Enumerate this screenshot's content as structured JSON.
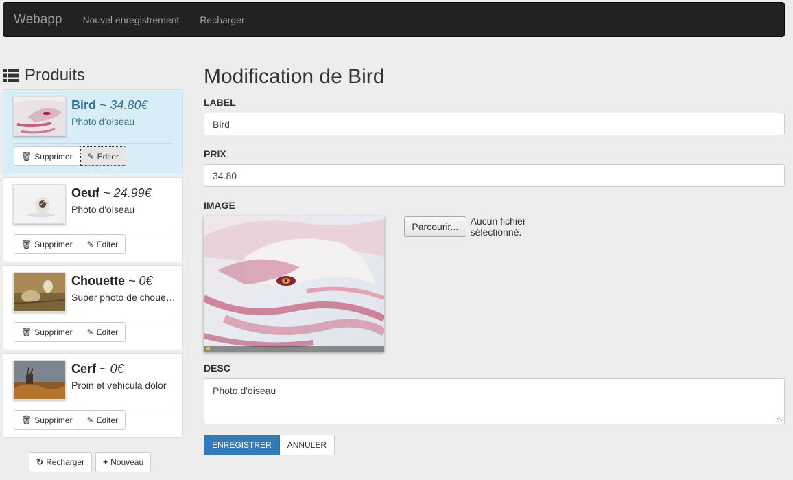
{
  "navbar": {
    "brand": "Webapp",
    "links": [
      "Nouvel enregistrement",
      "Recharger"
    ]
  },
  "sidebar": {
    "title": "Produits",
    "items": [
      {
        "name": "Bird",
        "price": "34.80€",
        "desc": "Photo d'oiseau",
        "active": true
      },
      {
        "name": "Oeuf",
        "price": "24.99€",
        "desc": "Photo d'oiseau",
        "active": false
      },
      {
        "name": "Chouette",
        "price": "0€",
        "desc": "Super photo de chouette",
        "active": false
      },
      {
        "name": "Cerf",
        "price": "0€",
        "desc": "Proin et vehicula dolor",
        "active": false
      }
    ],
    "separator": "~",
    "delete_label": "Supprimer",
    "edit_label": "Editer",
    "reload_label": "Recharger",
    "new_label": "Nouveau"
  },
  "form": {
    "title": "Modification de Bird",
    "label_label": "LABEL",
    "label_value": "Bird",
    "price_label": "PRIX",
    "price_value": "34.80",
    "image_label": "IMAGE",
    "browse_label": "Parcourir...",
    "file_status": "Aucun fichier sélectionné.",
    "desc_label": "DESC",
    "desc_value": "Photo d'oiseau",
    "save_label": "ENREGISTRER",
    "cancel_label": "ANNULER"
  },
  "colors": {
    "navbar_bg": "#222222",
    "active_item_bg": "#d9edf7",
    "active_text": "#31708f",
    "primary": "#337ab7"
  }
}
